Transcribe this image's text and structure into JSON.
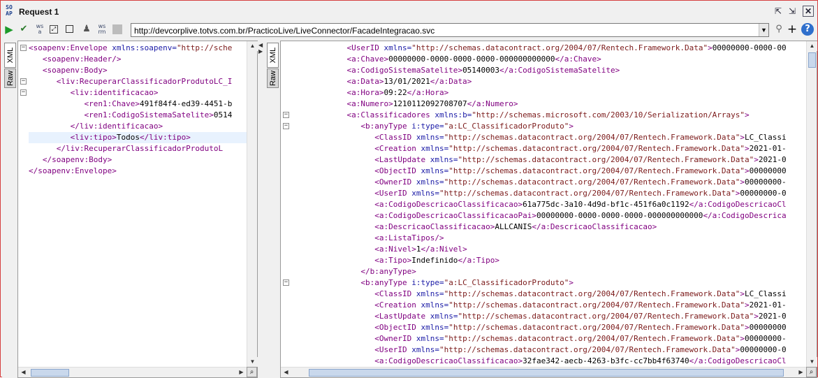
{
  "window": {
    "title": "Request 1",
    "logo_text": "SO AP"
  },
  "title_buttons": {
    "detach": "⇱",
    "maximize": "⇲",
    "close": "✕"
  },
  "toolbar": {
    "url": "http://devcorplive.totvs.com.br/PracticoLive/LiveConnector/FacadeIntegracao.svc",
    "dropdown_glyph": "▼",
    "add": "+",
    "help": "?"
  },
  "tabs": {
    "xml": "XML",
    "raw": "Raw"
  },
  "request_lines": [
    "<soapenv:Envelope xmlns:soapenv=\"http://sche",
    "   <soapenv:Header/>",
    "   <soapenv:Body>",
    "      <liv:RecuperarClassificadorProdutoLC_I",
    "         <liv:identificacao>",
    "            <ren1:Chave>491f84f4-ed39-4451-b",
    "            <ren1:CodigoSistemaSatelite>0514",
    "         </liv:identificacao>",
    "         <liv:tipo>Todos</liv:tipo>",
    "      </liv:RecuperarClassificadorProdutoL",
    "   </soapenv:Body>",
    "</soapenv:Envelope>"
  ],
  "response_lines": [
    "            <UserID xmlns=\"http://schemas.datacontract.org/2004/07/Rentech.Framework.Data\">00000000-0000-00",
    "            <a:Chave>00000000-0000-0000-0000-000000000000</a:Chave>",
    "            <a:CodigoSistemaSatelite>05140003</a:CodigoSistemaSatelite>",
    "            <a:Data>13/01/2021</a:Data>",
    "            <a:Hora>09:22</a:Hora>",
    "            <a:Numero>1210112092708707</a:Numero>",
    "            <a:Classificadores xmlns:b=\"http://schemas.microsoft.com/2003/10/Serialization/Arrays\">",
    "               <b:anyType i:type=\"a:LC_ClassificadorProduto\">",
    "                  <ClassID xmlns=\"http://schemas.datacontract.org/2004/07/Rentech.Framework.Data\">LC_Classi",
    "                  <Creation xmlns=\"http://schemas.datacontract.org/2004/07/Rentech.Framework.Data\">2021-01-",
    "                  <LastUpdate xmlns=\"http://schemas.datacontract.org/2004/07/Rentech.Framework.Data\">2021-0",
    "                  <ObjectID xmlns=\"http://schemas.datacontract.org/2004/07/Rentech.Framework.Data\">00000000",
    "                  <OwnerID xmlns=\"http://schemas.datacontract.org/2004/07/Rentech.Framework.Data\">00000000-",
    "                  <UserID xmlns=\"http://schemas.datacontract.org/2004/07/Rentech.Framework.Data\">00000000-0",
    "                  <a:CodigoDescricaoClassificacao>61a775dc-3a10-4d9d-bf1c-451f6a0c1192</a:CodigoDescricaoCl",
    "                  <a:CodigoDescricaoClassificacaoPai>00000000-0000-0000-0000-000000000000</a:CodigoDescrica",
    "                  <a:DescricaoClassificacao>ALLCANIS</a:DescricaoClassificacao>",
    "                  <a:ListaTipos/>",
    "                  <a:Nivel>1</a:Nivel>",
    "                  <a:Tipo>Indefinido</a:Tipo>",
    "               </b:anyType>",
    "               <b:anyType i:type=\"a:LC_ClassificadorProduto\">",
    "                  <ClassID xmlns=\"http://schemas.datacontract.org/2004/07/Rentech.Framework.Data\">LC_Classi",
    "                  <Creation xmlns=\"http://schemas.datacontract.org/2004/07/Rentech.Framework.Data\">2021-01-",
    "                  <LastUpdate xmlns=\"http://schemas.datacontract.org/2004/07/Rentech.Framework.Data\">2021-0",
    "                  <ObjectID xmlns=\"http://schemas.datacontract.org/2004/07/Rentech.Framework.Data\">00000000",
    "                  <OwnerID xmlns=\"http://schemas.datacontract.org/2004/07/Rentech.Framework.Data\">00000000-",
    "                  <UserID xmlns=\"http://schemas.datacontract.org/2004/07/Rentech.Framework.Data\">00000000-0",
    "                  <a:CodigoDescricaoClassificacao>32fae342-aecb-4263-b3fc-cc7bb4f63740</a:CodigoDescricaoCl"
  ],
  "colors": {
    "tag": "#800080",
    "attr": "#1a1aa6",
    "value": "#7b1a1a",
    "frame": "#d64040"
  },
  "icons": [
    "soapui-logo-icon",
    "run-icon",
    "validate-icon",
    "ws-a-icon",
    "ws-rm-icon",
    "stop-icon",
    "user-icon",
    "encode-icon",
    "disabled-icon",
    "attach-icon",
    "add-icon",
    "help-icon"
  ]
}
